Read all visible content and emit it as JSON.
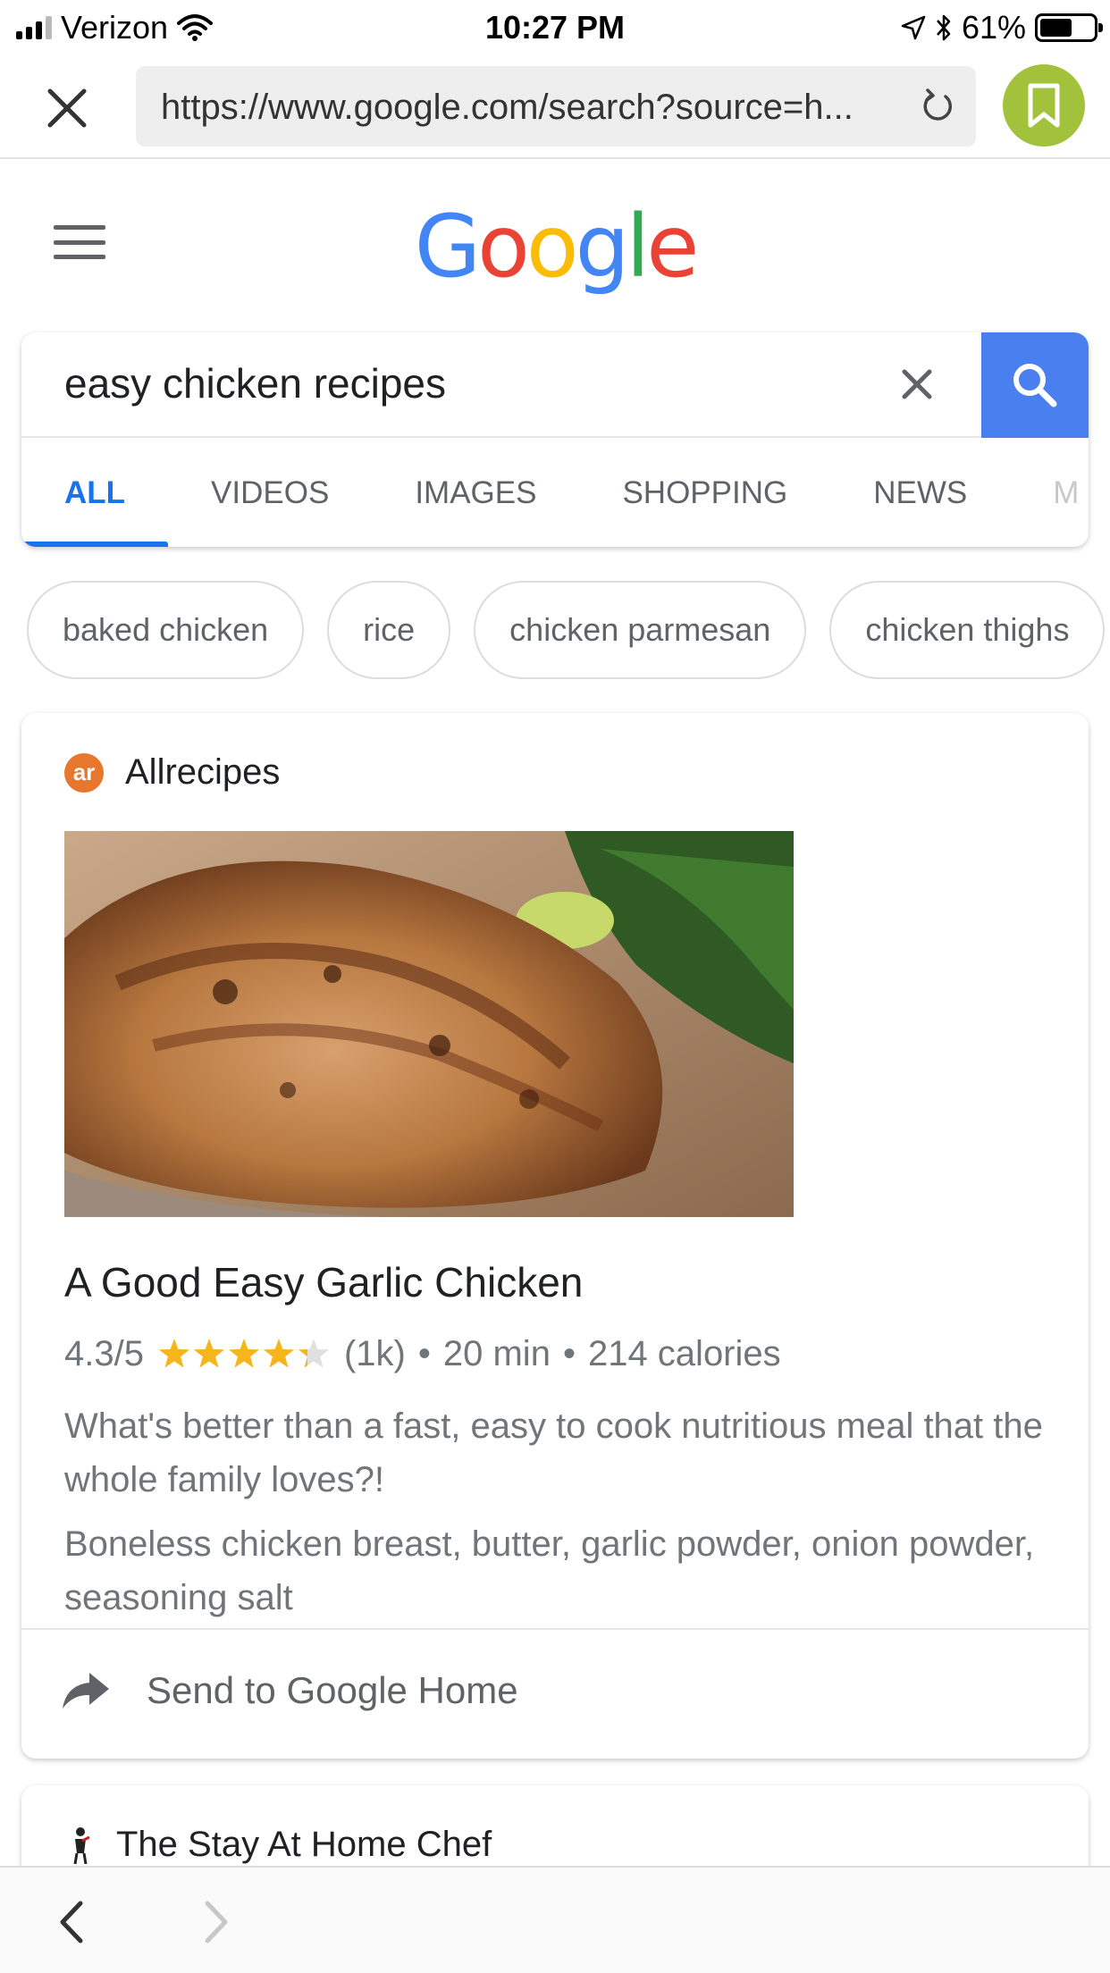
{
  "status_bar": {
    "carrier": "Verizon",
    "time": "10:27 PM",
    "battery": "61%",
    "battery_level": 0.61,
    "signal_bars": 3,
    "icons": [
      "signal-icon",
      "wifi-icon",
      "location-arrow-icon",
      "bluetooth-icon",
      "battery-icon"
    ]
  },
  "browser": {
    "url": "https://www.google.com/search?source=h...",
    "close_icon": "close-icon",
    "reload_icon": "reload-icon",
    "bookmark_icon": "bookmark-icon",
    "bookmark_color": "#a3c23b"
  },
  "google": {
    "logo_letters": [
      "G",
      "o",
      "o",
      "g",
      "l",
      "e"
    ],
    "logo_colors": [
      "#4285f4",
      "#ea4335",
      "#fbbc05",
      "#4285f4",
      "#34a853",
      "#ea4335"
    ],
    "menu_icon": "hamburger-menu-icon"
  },
  "search": {
    "query": "easy chicken recipes",
    "clear_icon": "clear-icon",
    "search_icon": "search-icon",
    "button_color": "#4a7ff0"
  },
  "tabs": [
    {
      "label": "ALL",
      "active": true
    },
    {
      "label": "VIDEOS",
      "active": false
    },
    {
      "label": "IMAGES",
      "active": false
    },
    {
      "label": "SHOPPING",
      "active": false
    },
    {
      "label": "NEWS",
      "active": false
    },
    {
      "label": "M",
      "active": false
    }
  ],
  "chips": [
    "baked chicken",
    "rice",
    "chicken parmesan",
    "chicken thighs"
  ],
  "result": {
    "source": "Allrecipes",
    "source_logo_text": "ar",
    "image_alt": "garlic-chicken-photo",
    "title": "A Good Easy Garlic Chicken",
    "rating": "4.3/5",
    "rating_value": 4.3,
    "rating_max": 5,
    "reviews": "(1k)",
    "time": "20 min",
    "calories": "214 calories",
    "separator": "•",
    "description": "What's better than a fast, easy to cook nutritious meal that the whole family loves?!",
    "ingredients": "Boneless chicken breast, butter, garlic powder, onion powder, seasoning salt",
    "send_label": "Send to Google Home",
    "send_icon": "share-arrow-icon"
  },
  "result2": {
    "source": "The Stay At Home Chef"
  },
  "bottom_bar": {
    "back_icon": "back-chevron-icon",
    "forward_icon": "forward-chevron-icon"
  }
}
